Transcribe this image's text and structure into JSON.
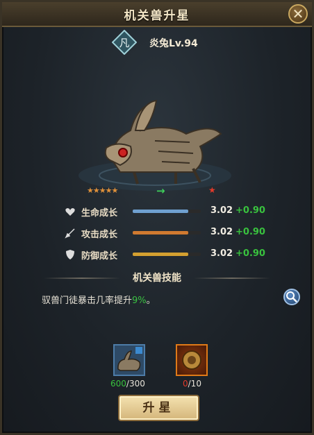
{
  "window": {
    "title": "机关兽升星",
    "close_icon": "close-icon"
  },
  "pet": {
    "rank_glyph": "凡",
    "name": "炎兔Lv.94",
    "stars": "★★★★★",
    "next_star": "★"
  },
  "stats": [
    {
      "label": "生命成长",
      "value": "3.02",
      "bonus": "+0.90",
      "icon": "heart-icon",
      "color": "#6fa0d0",
      "fill_fraction": 0.82
    },
    {
      "label": "攻击成长",
      "value": "3.02",
      "bonus": "+0.90",
      "icon": "sword-icon",
      "color": "#d07a30",
      "fill_fraction": 0.82
    },
    {
      "label": "防御成长",
      "value": "3.02",
      "bonus": "+0.90",
      "icon": "shield-icon",
      "color": "#d4a030",
      "fill_fraction": 0.82
    }
  ],
  "skill": {
    "header": "机关兽技能",
    "desc_prefix": "驭兽门徒暴击几率提升",
    "desc_highlight": "9%",
    "desc_suffix": "。"
  },
  "materials": [
    {
      "have": "600",
      "need": "/300",
      "icon": "rabbit-fragment-icon"
    },
    {
      "have": "0",
      "need": "/10",
      "icon": "gear-core-icon"
    }
  ],
  "upgrade_label": "升星"
}
